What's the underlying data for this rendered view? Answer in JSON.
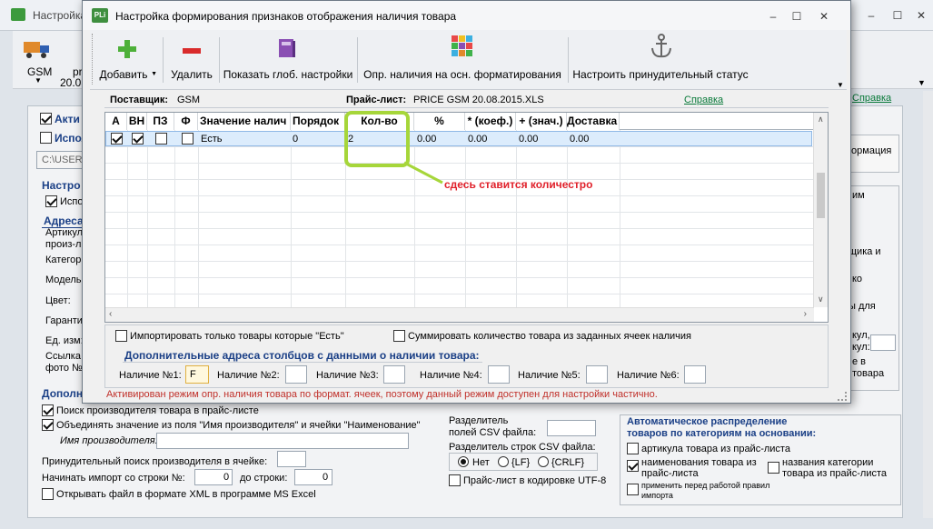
{
  "main_window": {
    "title": "Настройка",
    "toolbar": {
      "gsm_label": "GSM",
      "pr_label": "pr",
      "date_label": "20.08"
    },
    "link": "Справка",
    "left_panel": {
      "import_caption": "Акти",
      "use_caption": "Испол",
      "path_value": "C:\\USERS",
      "settings_caption": "Настро",
      "use2_caption": "Испо",
      "addresses_caption": "Адреса",
      "rows": [
        "Артикул",
        "произ-л",
        "Категор",
        "Модель",
        "Цвет:",
        "Гаранти",
        "Ед. изм:",
        "Ссылка",
        "фото №"
      ],
      "additional_caption": "Дополн",
      "search_producer": "Поиск производителя товара в прайс-листе",
      "merge_values": "Объединять значение из поля \"Имя производителя\" и ячейки \"Наименование\"",
      "producer_name_label": "Имя производителя:",
      "forced_search": "Принудительный поиск производителя в ячейке:",
      "start_import": "Начинать импорт со строки №:",
      "start_value": "0",
      "to_row": "до строки:",
      "to_value": "0",
      "open_xml": "Открывать файл в формате XML в программе MS Excel"
    },
    "middle_panel": {
      "delimiter": "Разделитель",
      "csv_fields": "полей CSV файла:",
      "csv_rows": "Разделитель строк CSV файла:",
      "radio_no": "Нет",
      "radio_lf": "{LF}",
      "radio_crlf": "{CRLF}",
      "utf8": "Прайс-лист в кодировке UTF-8"
    },
    "right_panel": {
      "formation": "формация",
      "im": "им",
      "shchika": "щика и",
      "ko": "ко",
      "dlya": "ы для",
      "kul": "кул,",
      "kul2": "кул:",
      "e_v": "е в",
      "tovara": "товара",
      "auto_title": "Автоматическое распределение товаров по категориям на основании:",
      "art": "артикула товара из прайс-листа",
      "name": "наименования товара из прайс-листа",
      "cat": "названия категории товара из прайс-листа",
      "apply": "применить перед работой правил импорта"
    }
  },
  "dialog": {
    "icon_text": "PLi",
    "title": "Настройка формирования признаков отображения наличия товара",
    "toolbar": {
      "add": "Добавить",
      "delete": "Удалить",
      "show_global": "Показать глоб. настройки",
      "availability": "Опр. наличия на осн. форматирования",
      "forced_status": "Настроить принудительный статус"
    },
    "supplier_label": "Поставщик:",
    "supplier_value": "GSM",
    "price_label": "Прайс-лист:",
    "price_value": "PRICE GSM 20.08.2015.XLS",
    "help_link": "Справка",
    "grid": {
      "columns": [
        "А",
        "ВН",
        "ПЗ",
        "Ф",
        "Значение налич",
        "Порядок",
        "Кол-во",
        "%",
        "* (коеф.)",
        "+ (знач.)",
        "Доставка"
      ],
      "row": {
        "a": true,
        "vn": true,
        "pz": false,
        "f": false,
        "value": "Есть",
        "order": "0",
        "qty": "2",
        "pct": "0.00",
        "coef": "0.00",
        "plus": "0.00",
        "delivery": "0.00"
      }
    },
    "annotation": "сдесь ставится количестро",
    "import_only": "Импортировать только товары которые \"Есть\"",
    "sum_qty": "Суммировать количество товара из заданных ячеек наличия",
    "additional_title": "Дополнительные адреса столбцов с данными о наличии товара:",
    "availability_fields": [
      {
        "label": "Наличие №1:",
        "value": "F"
      },
      {
        "label": "Наличие №2:",
        "value": ""
      },
      {
        "label": "Наличие №3:",
        "value": ""
      },
      {
        "label": "Наличие №4:",
        "value": ""
      },
      {
        "label": "Наличие №5:",
        "value": ""
      },
      {
        "label": "Наличие №6:",
        "value": ""
      }
    ],
    "status_message": "Активирован режим опр. наличия товара по формат. ячеек, поэтому данный режим доступен для настройки частично."
  },
  "colors": {
    "section_blue": "#1a3f86",
    "link_green": "#0a7a3a",
    "annotation_red": "#e0202a",
    "highlight_green": "#a6d63a",
    "selected_row": "#dcecfc"
  }
}
